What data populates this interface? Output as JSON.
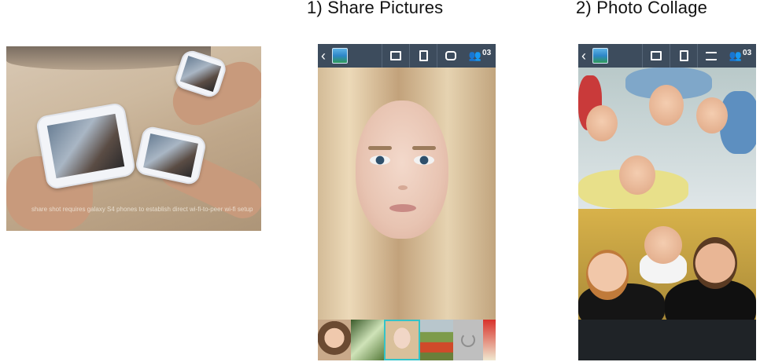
{
  "captions": {
    "share": "1) Share Pictures",
    "collage": "2) Photo Collage"
  },
  "promo": {
    "fine_print": "share shot requires galaxy S4 phones to establish direct wi-fi-to-peer wi-fi setup"
  },
  "phone_share": {
    "back_glyph": "‹",
    "people_count": "03",
    "icons": [
      "back-icon",
      "gallery-icon",
      "edit-icon",
      "document-icon",
      "share-icon",
      "people-icon"
    ],
    "filmstrip": [
      "child-thumb",
      "grass-thumb",
      "girl-thumb",
      "flowers-thumb",
      "loading-thumb",
      "red-thumb"
    ]
  },
  "phone_collage": {
    "back_glyph": "‹",
    "people_count": "03",
    "icons": [
      "back-icon",
      "gallery-icon",
      "edit-icon",
      "document-icon",
      "list-icon",
      "people-icon"
    ]
  },
  "colors": {
    "toolbar": "#3d4c5d",
    "selected_thumb_border": "#34c3c8"
  }
}
